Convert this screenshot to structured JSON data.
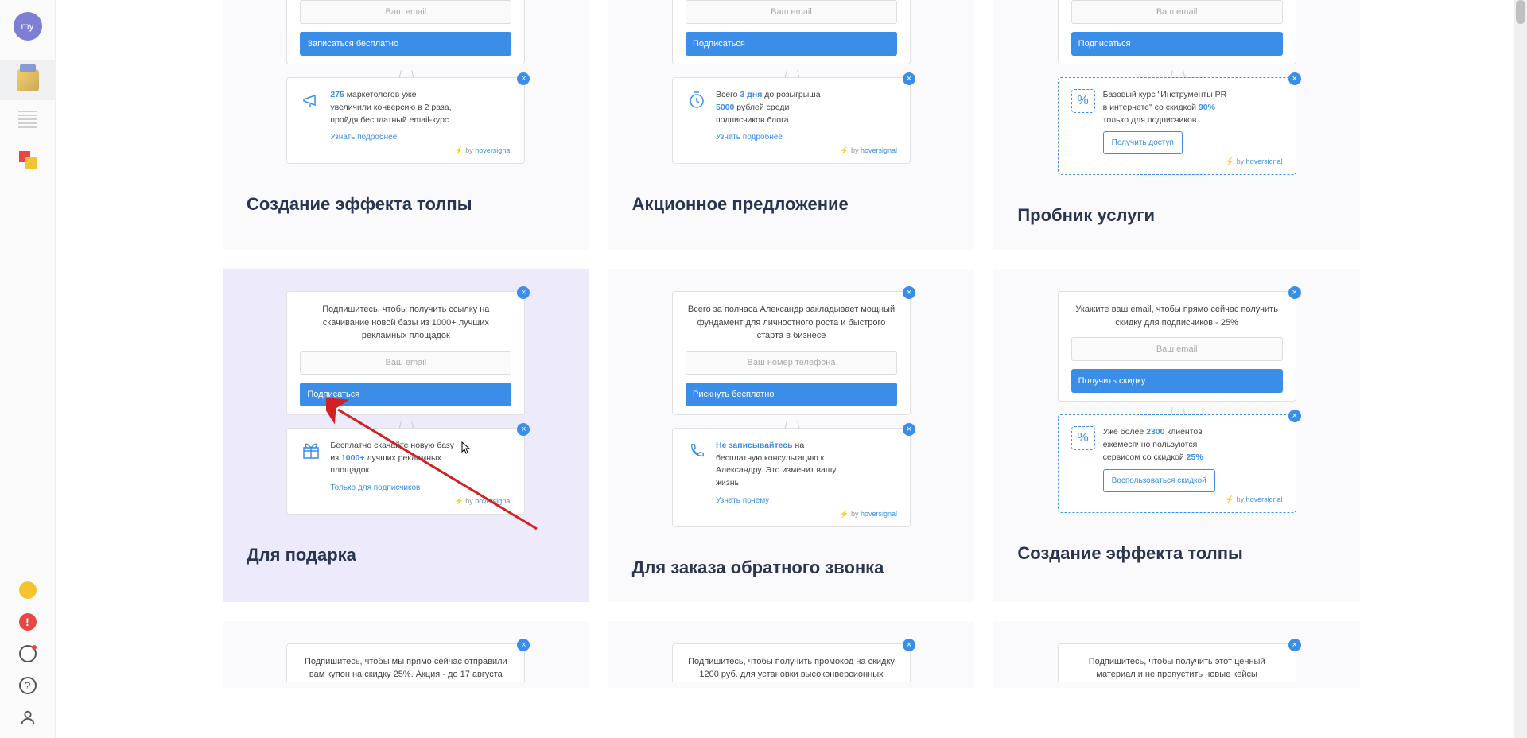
{
  "sidebar": {
    "avatar": "my"
  },
  "cards": [
    {
      "title": "Создание эффекта толпы",
      "top": {
        "placeholder": "Ваш email",
        "button": "Записаться бесплатно"
      },
      "bottom": {
        "badge": "275",
        "line1": "маркетологов уже",
        "line2": "увеличили конверсию в 2 раза,",
        "line3": "пройдя бесплатный email-курс",
        "link": "Узнать подробнее"
      }
    },
    {
      "title": "Акционное предложение",
      "top": {
        "placeholder": "Ваш email",
        "button": "Подписаться"
      },
      "bottom": {
        "pre": "Всего",
        "badge1": "3 дня",
        "mid": "до розыгрыша",
        "badge2": "5000",
        "line2": "рублей среди",
        "line3": "подписчиков блога",
        "link": "Узнать подробнее"
      }
    },
    {
      "title": "Пробник услуги",
      "top": {
        "placeholder": "Ваш email",
        "button": "Подписаться"
      },
      "bottom": {
        "line1": "Базовый курс \"Инструменты PR",
        "line2": "в интернете\" со скидкой",
        "badge": "90%",
        "line3": "только для подписчиков",
        "button": "Получить доступ"
      }
    },
    {
      "title": "Для подарка",
      "highlighted": true,
      "top": {
        "text": "Подпишитесь, чтобы получить ссылку на скачивание новой базы из 1000+ лучших рекламных площадок",
        "placeholder": "Ваш email",
        "button": "Подписаться"
      },
      "bottom": {
        "line1": "Бесплатно скачайте новую базу",
        "pre2": "из",
        "badge": "1000+",
        "post2": "лучших рекламных",
        "line3": "площадок",
        "link": "Только для подписчиков"
      }
    },
    {
      "title": "Для заказа обратного звонка",
      "top": {
        "text": "Всего за полчаса Александр закладывает мощный фундамент для личностного роста и быстрого старта в бизнесе",
        "placeholder": "Ваш номер телефона",
        "button": "Рискнуть бесплатно"
      },
      "bottom": {
        "badge": "Не записывайтесь",
        "post1": "на",
        "line2": "бесплатную консультацию к",
        "line3": "Александру. Это изменит вашу",
        "line4": "жизнь!",
        "link": "Узнать почему"
      }
    },
    {
      "title": "Создание эффекта толпы",
      "top": {
        "text": "Укажите ваш email, чтобы прямо сейчас получить скидку для подписчиков - 25%",
        "placeholder": "Ваш email",
        "button": "Получить скидку"
      },
      "bottom": {
        "pre": "Уже более",
        "badge1": "2300",
        "post1": "клиентов",
        "line2": "ежемесячно пользуются",
        "pre3": "сервисом со скидкой",
        "badge2": "25%",
        "button": "Воспользоваться скидкой"
      }
    },
    {
      "title": "",
      "top": {
        "text": "Подпишитесь, чтобы мы прямо сейчас отправили вам купон на скидку 25%. Акция - до 17 августа"
      }
    },
    {
      "title": "",
      "top": {
        "text": "Подпишитесь, чтобы получить промокод на скидку 1200 руб. для установки высоконверсионных"
      }
    },
    {
      "title": "",
      "top": {
        "text": "Подпишитесь, чтобы получить этот ценный материал и не пропустить новые кейсы"
      }
    }
  ],
  "credit": {
    "prefix": "⚡ by ",
    "name": "hoversignal"
  }
}
